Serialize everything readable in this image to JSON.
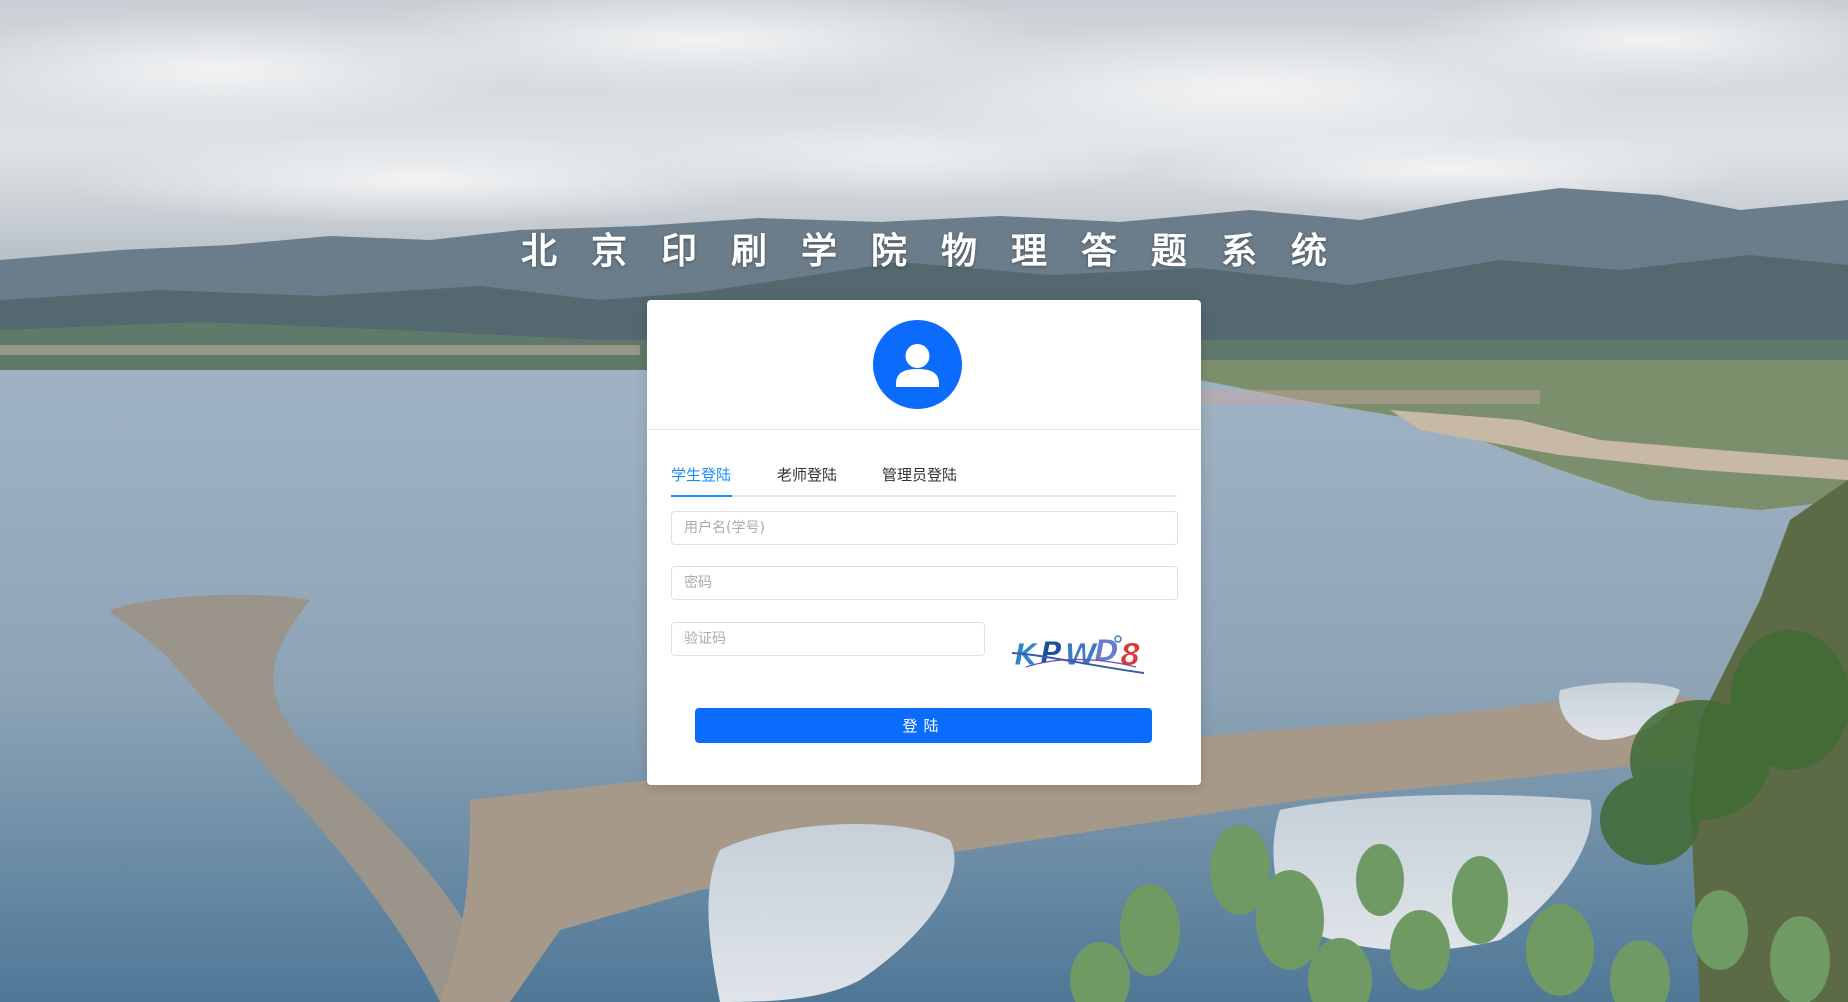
{
  "page": {
    "title": "北京印刷学院物理答题系统"
  },
  "tabs": [
    {
      "label": "学生登陆",
      "active": true
    },
    {
      "label": "老师登陆",
      "active": false
    },
    {
      "label": "管理员登陆",
      "active": false
    }
  ],
  "form": {
    "username_placeholder": "用户名(学号)",
    "password_placeholder": "密码",
    "captcha_placeholder": "验证码",
    "captcha_text": "KPWD8",
    "submit_label": "登陆"
  },
  "colors": {
    "primary": "#0b6bfd",
    "tab_active": "#1a8cff"
  }
}
